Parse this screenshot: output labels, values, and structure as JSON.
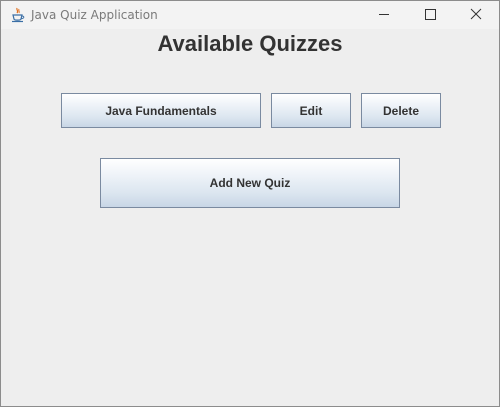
{
  "window": {
    "title": "Java Quiz Application",
    "icon": "java-cup-icon",
    "controls": [
      "minimize-icon",
      "maximize-icon",
      "close-icon"
    ]
  },
  "main": {
    "heading": "Available Quizzes",
    "quizzes": [
      {
        "name": "Java Fundamentals",
        "edit_label": "Edit",
        "delete_label": "Delete"
      }
    ],
    "add_button_label": "Add New Quiz"
  },
  "colors": {
    "background": "#eeeeee",
    "titlebar": "#f3f3f3",
    "button_border": "#7a8aa0",
    "button_gradient_top": "#ffffff",
    "button_gradient_bottom": "#c8d6e6",
    "text": "#333333"
  }
}
